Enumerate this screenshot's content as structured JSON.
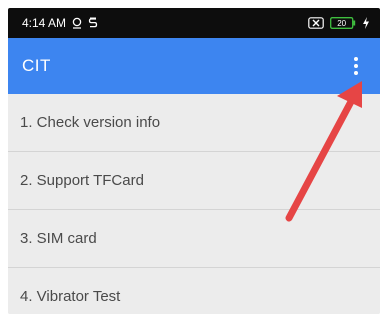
{
  "status_bar": {
    "time": "4:14 AM",
    "battery_level": "20",
    "icons": [
      "alarm-icon",
      "s-icon",
      "mute-icon",
      "battery-icon",
      "charging-icon"
    ]
  },
  "app_bar": {
    "title": "CIT",
    "color": "#3d85f0",
    "overflow_icon": "vertical-dots-icon"
  },
  "list": {
    "items": [
      {
        "label": "1. Check version info"
      },
      {
        "label": "2. Support TFCard"
      },
      {
        "label": "3. SIM card"
      },
      {
        "label": "4. Vibrator Test"
      }
    ]
  },
  "annotation": {
    "arrow_color": "#e64545"
  }
}
